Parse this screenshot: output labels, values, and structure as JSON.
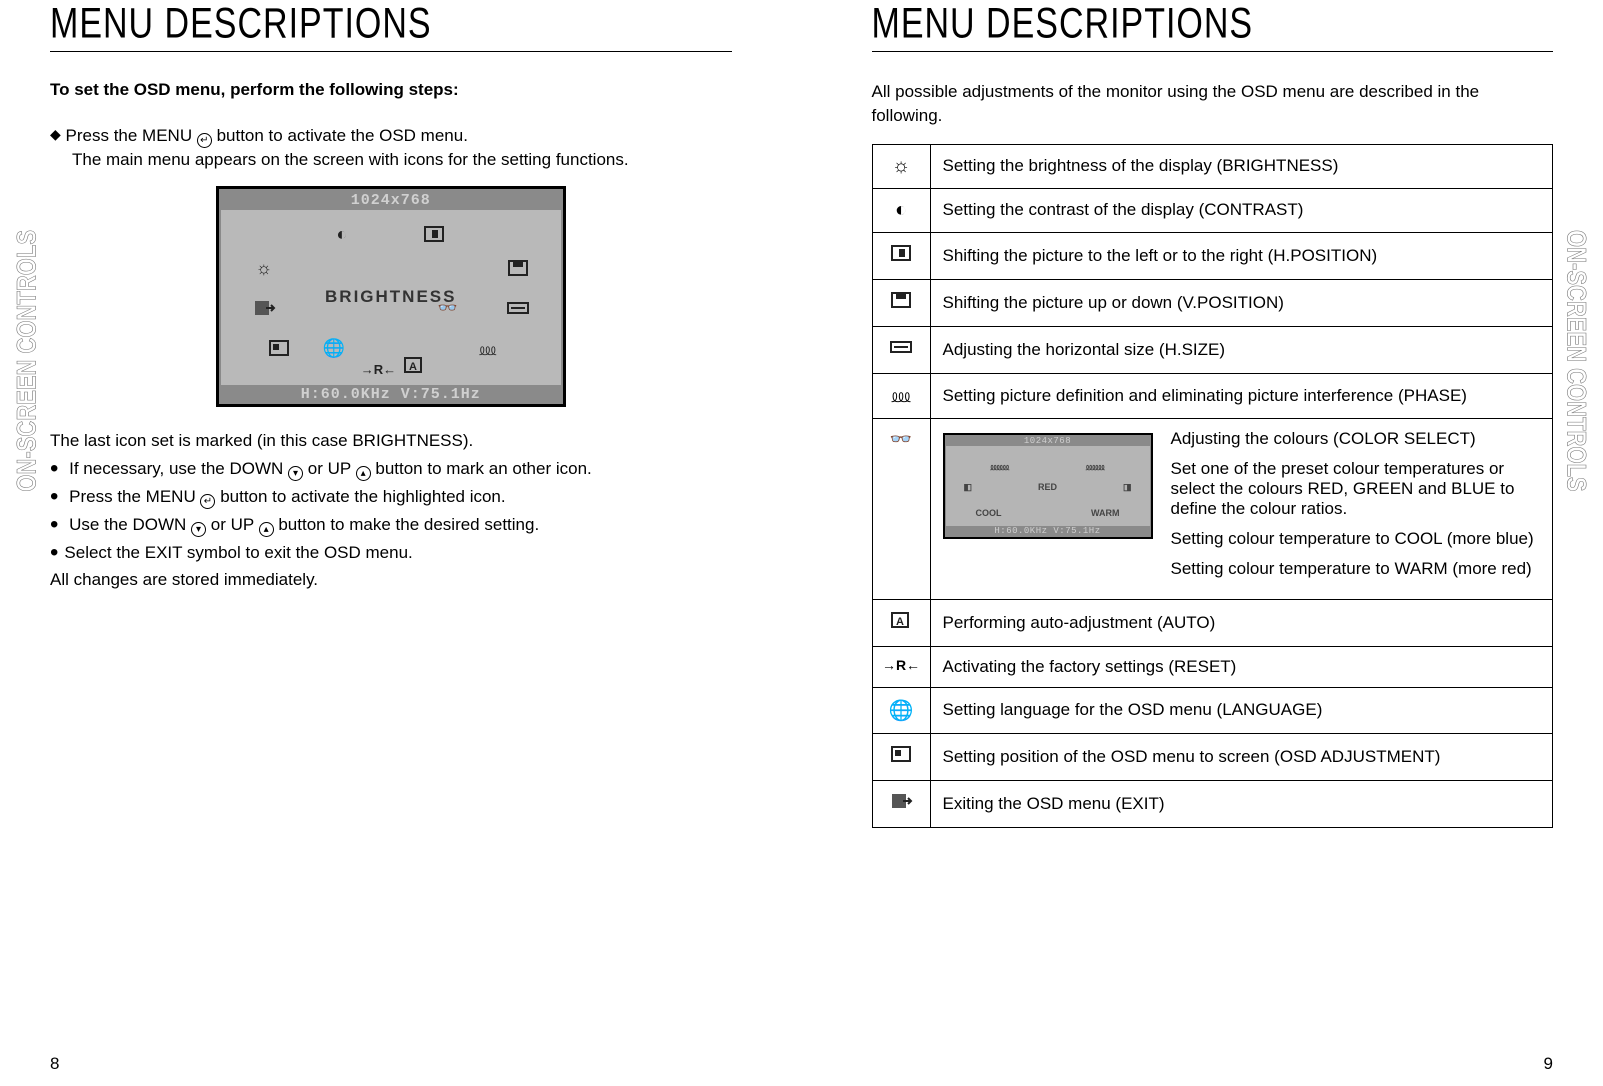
{
  "sideTab": "ON-SCREEN CONTROLS",
  "left": {
    "title": "MENU DESCRIPTIONS",
    "intro": "To set the OSD menu, perform the following steps:",
    "step1a": "Press the MENU ",
    "step1b": " button to activate the OSD menu.",
    "step1c": "The main menu appears on the screen with icons for the setting functions.",
    "osdHead": "1024x768",
    "osdCenter": "BRIGHTNESS",
    "osdFoot": "H:60.0KHz V:75.1Hz",
    "afterImg": "The last icon set  is marked (in this case BRIGHTNESS).",
    "b1": "If necessary, use the DOWN ",
    "b1m": "  or UP  ",
    "b1e": " button to mark an other icon.",
    "b2a": "Press the MENU ",
    "b2b": " button to activate the highlighted icon.",
    "b3a": "Use the DOWN  ",
    "b3m": " or UP  ",
    "b3e": " button to make the desired setting.",
    "b4": "Select the EXIT symbol to exit the OSD menu.",
    "b5": "All changes are stored immediately.",
    "pageNum": "8"
  },
  "right": {
    "title": "MENU DESCRIPTIONS",
    "intro": "All possible adjustments of the monitor using the OSD menu are described in the following.",
    "rows": {
      "r1": "Setting the brightness of the display (BRIGHTNESS)",
      "r2": "Setting the contrast of the display (CONTRAST)",
      "r3": "Shifting the picture to the left or to the right (H.POSITION)",
      "r4": "Shifting the picture up or down (V.POSITION)",
      "r5": "Adjusting the horizontal size (H.SIZE)",
      "r6": "Setting picture definition and eliminating picture interference (PHASE)",
      "r7a": "Adjusting the colours (COLOR SELECT)",
      "r7b": "Set one of the preset colour temperatures or select the colours RED, GREEN and BLUE to define the colour ratios.",
      "r7c": "Setting colour temperature to COOL (more blue)",
      "r7d": "Setting colour temperature to WARM (more red)",
      "r8": "Performing auto-adjustment (AUTO)",
      "r9": "Activating the factory settings (RESET)",
      "r10": "Setting language for the OSD menu (LANGUAGE)",
      "r11": "Setting position of the OSD menu to screen (OSD ADJUSTMENT)",
      "r12": "Exiting the OSD menu (EXIT)"
    },
    "subHead": "1024x768",
    "subCenter": "RED",
    "subCool": "COOL",
    "subWarm": "WARM",
    "subFoot": "H:60.0KHz V:75.1Hz",
    "pageNum": "9"
  }
}
